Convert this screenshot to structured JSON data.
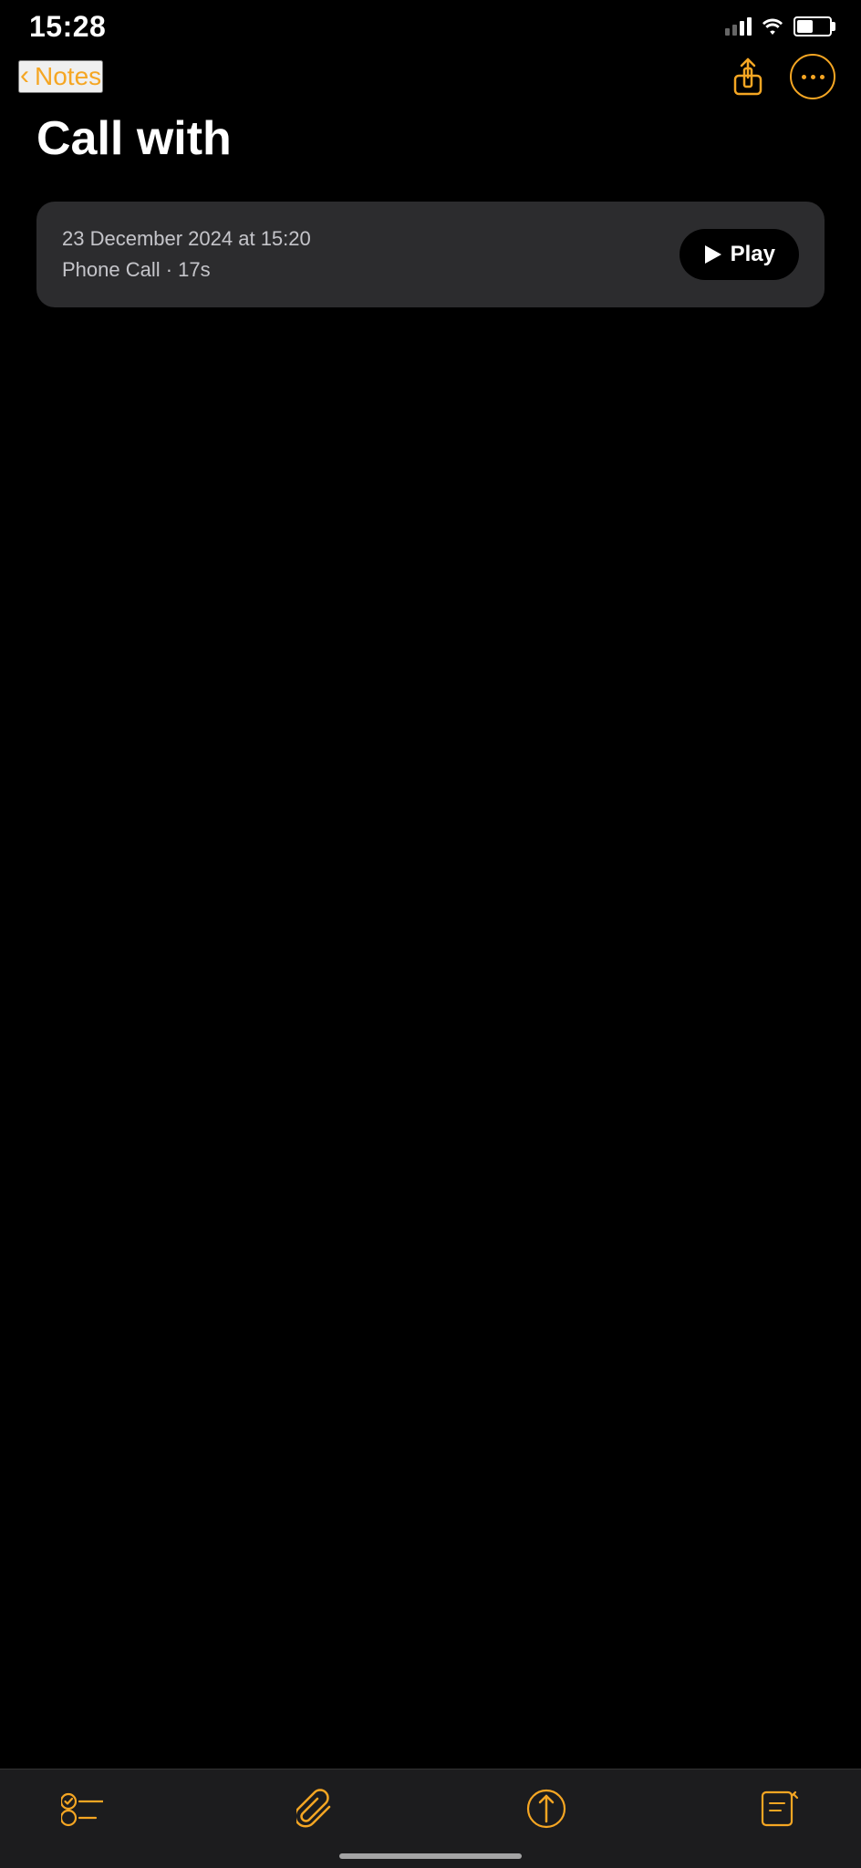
{
  "status_bar": {
    "time": "15:28"
  },
  "nav": {
    "back_label": "Notes",
    "share_icon": "share-icon",
    "more_icon": "more-icon"
  },
  "note": {
    "title": "Call with"
  },
  "audio_card": {
    "date": "23 December 2024 at 15:20",
    "meta": "Phone Call · 17s",
    "play_label": "Play"
  },
  "toolbar": {
    "checklist_icon": "checklist-icon",
    "attachment_icon": "attachment-icon",
    "compose_icon": "compose-icon",
    "markup_icon": "markup-icon"
  }
}
